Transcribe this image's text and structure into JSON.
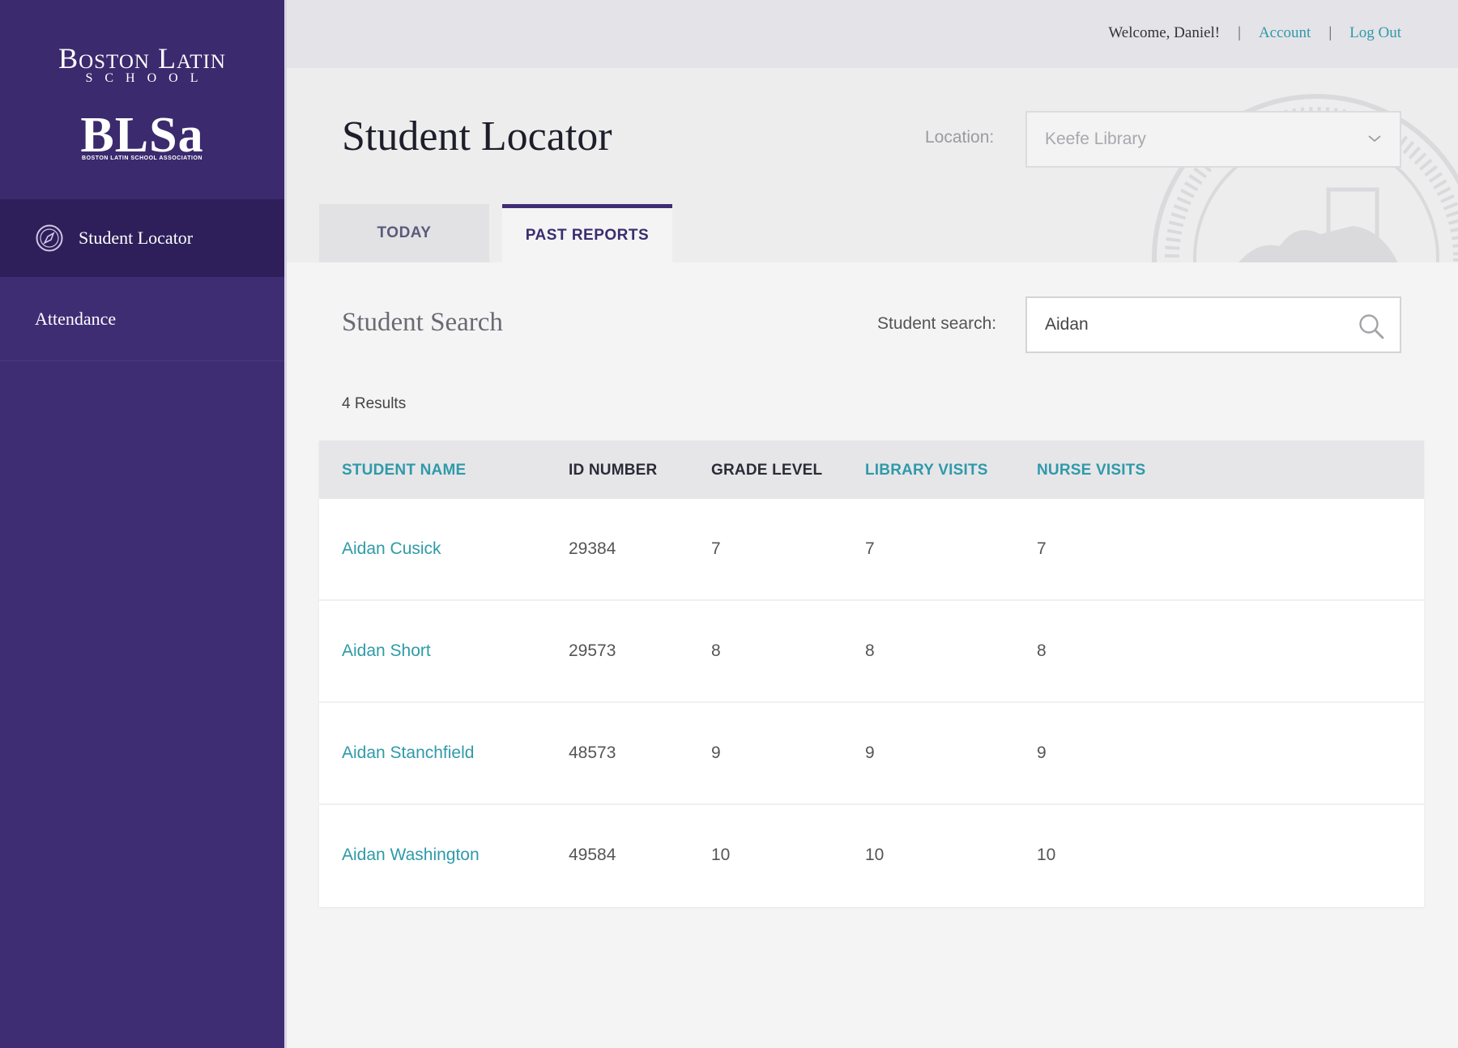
{
  "sidebar": {
    "logo_school": "Boston Latin",
    "logo_school_sub": "SCHOOL",
    "logo_blsa": "BLSa",
    "logo_blsa_sub": "BOSTON LATIN SCHOOL ASSOCIATION",
    "items": [
      {
        "label": "Student Locator",
        "active": true,
        "icon": "compass-icon"
      },
      {
        "label": "Attendance",
        "active": false
      }
    ]
  },
  "topbar": {
    "welcome": "Welcome, Daniel!",
    "separator": "|",
    "account": "Account",
    "logout": "Log Out"
  },
  "header": {
    "title": "Student Locator",
    "location_label": "Location:",
    "location_value": "Keefe Library",
    "tabs": [
      {
        "label": "TODAY",
        "active": false
      },
      {
        "label": "PAST REPORTS",
        "active": true
      }
    ]
  },
  "search": {
    "title": "Student Search",
    "label": "Student search:",
    "value": "Aidan",
    "results_count": "4 Results"
  },
  "table": {
    "columns": [
      "STUDENT NAME",
      "ID NUMBER",
      "GRADE LEVEL",
      "LIBRARY VISITS",
      "NURSE VISITS"
    ],
    "rows": [
      {
        "name": "Aidan Cusick",
        "id": "29384",
        "grade": "7",
        "library": "7",
        "nurse": "7"
      },
      {
        "name": "Aidan Short",
        "id": "29573",
        "grade": "8",
        "library": "8",
        "nurse": "8"
      },
      {
        "name": "Aidan Stanchfield",
        "id": "48573",
        "grade": "9",
        "library": "9",
        "nurse": "9"
      },
      {
        "name": "Aidan Washington",
        "id": "49584",
        "grade": "10",
        "library": "10",
        "nurse": "10"
      }
    ]
  },
  "colors": {
    "sidebar": "#3f2d74",
    "sidebar_active": "#2e1f5a",
    "accent_link": "#2f9aa9",
    "title_text": "#1e1e2a"
  }
}
